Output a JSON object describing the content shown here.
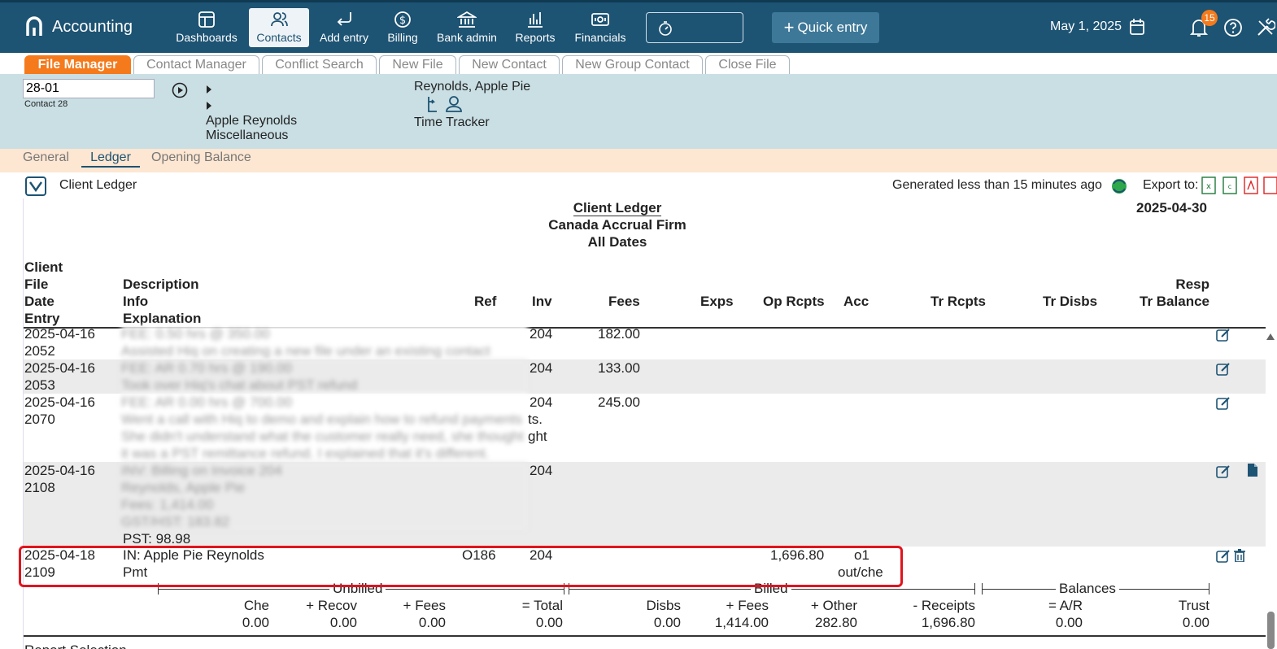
{
  "app": {
    "title": "Accounting"
  },
  "nav": [
    {
      "label": "Dashboards",
      "icon": "dashboard-icon"
    },
    {
      "label": "Contacts",
      "icon": "contacts-icon",
      "active": true
    },
    {
      "label": "Add entry",
      "icon": "add-entry-icon"
    },
    {
      "label": "Billing",
      "icon": "billing-icon"
    },
    {
      "label": "Bank admin",
      "icon": "bank-icon"
    },
    {
      "label": "Reports",
      "icon": "reports-icon"
    },
    {
      "label": "Financials",
      "icon": "financials-icon"
    }
  ],
  "quick_entry": {
    "label": "Quick entry"
  },
  "header_date": "May 1, 2025",
  "notifications": {
    "count": "15"
  },
  "tabs": [
    {
      "label": "File Manager",
      "active": true
    },
    {
      "label": "Contact Manager"
    },
    {
      "label": "Conflict Search"
    },
    {
      "label": "New File"
    },
    {
      "label": "New Contact"
    },
    {
      "label": "New Group Contact"
    },
    {
      "label": "Close File"
    }
  ],
  "file": {
    "number": "28-01",
    "contact": "Contact 28",
    "desc_line1": "Apple Reynolds",
    "desc_line2": "Miscellaneous",
    "client_name": "Reynolds, Apple Pie",
    "time_tracker": "Time Tracker"
  },
  "subtabs": [
    {
      "label": "General"
    },
    {
      "label": "Ledger",
      "active": true
    },
    {
      "label": "Opening Balance"
    }
  ],
  "ledger_bar": {
    "title": "Client Ledger",
    "generated": "Generated less than 15 minutes ago",
    "export_label": "Export to:"
  },
  "report": {
    "title": "Client Ledger",
    "firm": "Canada Accrual Firm",
    "range": "All Dates",
    "date": "2025-04-30",
    "columns": {
      "client": "Client",
      "file": "File",
      "date": "Date",
      "entry": "Entry",
      "description": "Description",
      "info": "Info",
      "explanation": "Explanation",
      "ref": "Ref",
      "inv": "Inv",
      "fees": "Fees",
      "exps": "Exps",
      "op_rcpts": "Op Rcpts",
      "acc": "Acc",
      "tr_rcpts": "Tr Rcpts",
      "tr_disbs": "Tr Disbs",
      "resp": "Resp",
      "tr_balance": "Tr Balance"
    },
    "rows": [
      {
        "date": "2025-04-16",
        "entry": "2052",
        "inv": "204",
        "fees": "182.00",
        "blurred": [
          "FEE: 0.50 hrs @ 350.00",
          "Assisted Hiq on creating a new file under an existing contact"
        ]
      },
      {
        "date": "2025-04-16",
        "entry": "2053",
        "inv": "204",
        "fees": "133.00",
        "blurred": [
          "FEE: AR 0.70 hrs @ 190.00",
          "Took over Hiq's chat about PST refund"
        ]
      },
      {
        "date": "2025-04-16",
        "entry": "2070",
        "inv": "204",
        "fees": "245.00",
        "blurred": [
          "FEE: AR 0.00 hrs @ 700.00",
          "Went a call with Hiq to demo and explain how to refund payments",
          "She didn't understand what the customer really need, she thought",
          "it was a PST remittance refund. I explained that it's different."
        ],
        "tail1": "ts.",
        "tail2": "ght"
      },
      {
        "date": "2025-04-16",
        "entry": "2108",
        "inv": "204",
        "blurred": [
          "INV: Billing on Invoice 204",
          "Reynolds, Apple Pie",
          "Fees: 1,414.00",
          "GST/HST: 183.82"
        ],
        "pst": "PST: 98.98"
      },
      {
        "date": "2025-04-18",
        "entry": "2109",
        "description": "IN: Apple Pie Reynolds",
        "info": "Pmt",
        "ref": "O186",
        "inv": "204",
        "op_rcpts": "1,696.80",
        "acc": "o1",
        "acc2": "out/che"
      }
    ],
    "summary": {
      "unbilled_label": "Unbilled",
      "billed_label": "Billed",
      "balances_label": "Balances",
      "heads": [
        "Che",
        "+ Recov",
        "+ Fees",
        "= Total",
        "Disbs",
        "+ Fees",
        "+ Other",
        "- Receipts",
        "= A/R",
        "Trust"
      ],
      "values": [
        "0.00",
        "0.00",
        "0.00",
        "0.00",
        "0.00",
        "1,414.00",
        "282.80",
        "1,696.80",
        "0.00",
        "0.00"
      ]
    },
    "footer_partial": "Report Selection"
  }
}
